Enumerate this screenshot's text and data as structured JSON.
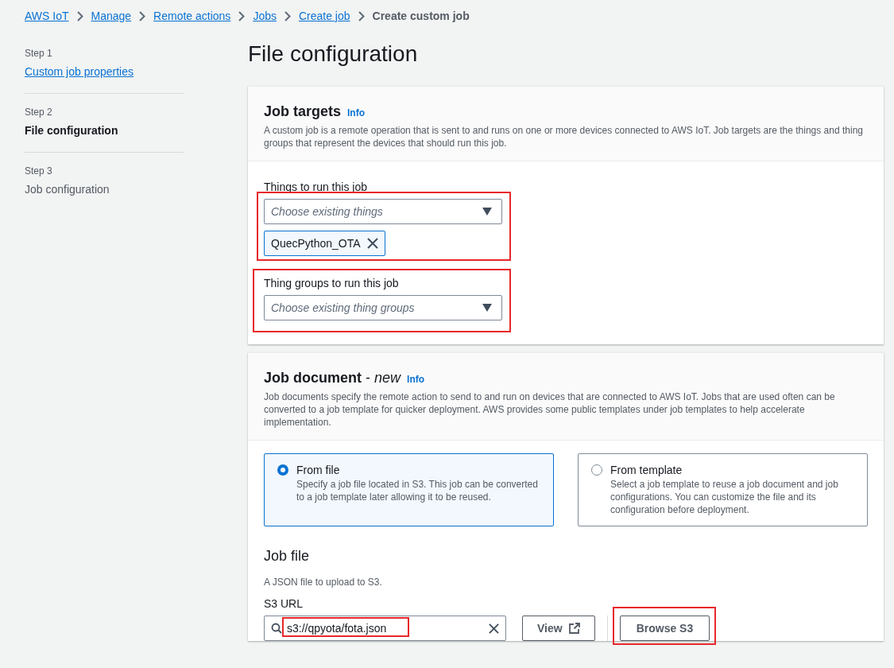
{
  "breadcrumbs": [
    {
      "label": "AWS IoT",
      "kind": "link"
    },
    {
      "label": "Manage",
      "kind": "link"
    },
    {
      "label": "Remote actions",
      "kind": "link"
    },
    {
      "label": "Jobs",
      "kind": "link"
    },
    {
      "label": "Create job",
      "kind": "link"
    },
    {
      "label": "Create custom job",
      "kind": "current"
    }
  ],
  "steps": [
    {
      "step": "Step 1",
      "title": "Custom job properties",
      "kind": "link"
    },
    {
      "step": "Step 2",
      "title": "File configuration",
      "kind": "current"
    },
    {
      "step": "Step 3",
      "title": "Job configuration",
      "kind": "upcoming"
    }
  ],
  "page_title": "File configuration",
  "job_targets": {
    "title": "Job targets",
    "info": "Info",
    "description": "A custom job is a remote operation that is sent to and runs on one or more devices connected to AWS IoT. Job targets are the things and thing groups that represent the devices that should run this job.",
    "things": {
      "label": "Things to run this job",
      "placeholder": "Choose existing things",
      "highlighted": true,
      "tokens": [
        "QuecPython_OTA"
      ]
    },
    "thing_groups": {
      "label": "Thing groups to run this job",
      "placeholder": "Choose existing thing groups",
      "highlighted": true
    }
  },
  "job_document": {
    "title": "Job document",
    "title_separator": "-",
    "title_suffix": "new",
    "info": "Info",
    "description": "Job documents specify the remote action to send to and run on devices that are connected to AWS IoT. Jobs that are used often can be converted to a job template for quicker deployment. AWS provides some public templates under job templates to help accelerate implementation.",
    "options": [
      {
        "label": "From file",
        "description": "Specify a job file located in S3. This job can be converted to a job template later allowing it to be reused.",
        "selected": true
      },
      {
        "label": "From template",
        "description": "Select a job template to reuse a job document and job configurations. You can customize the file and its configuration before deployment.",
        "selected": false
      }
    ],
    "job_file": {
      "heading": "Job file",
      "description": "A JSON file to upload to S3.",
      "s3_url": {
        "label": "S3 URL",
        "value": "s3://qpyota/fota.json",
        "highlighted": true
      },
      "view_button": "View",
      "browse_button": {
        "label": "Browse S3",
        "highlighted": true
      }
    }
  }
}
